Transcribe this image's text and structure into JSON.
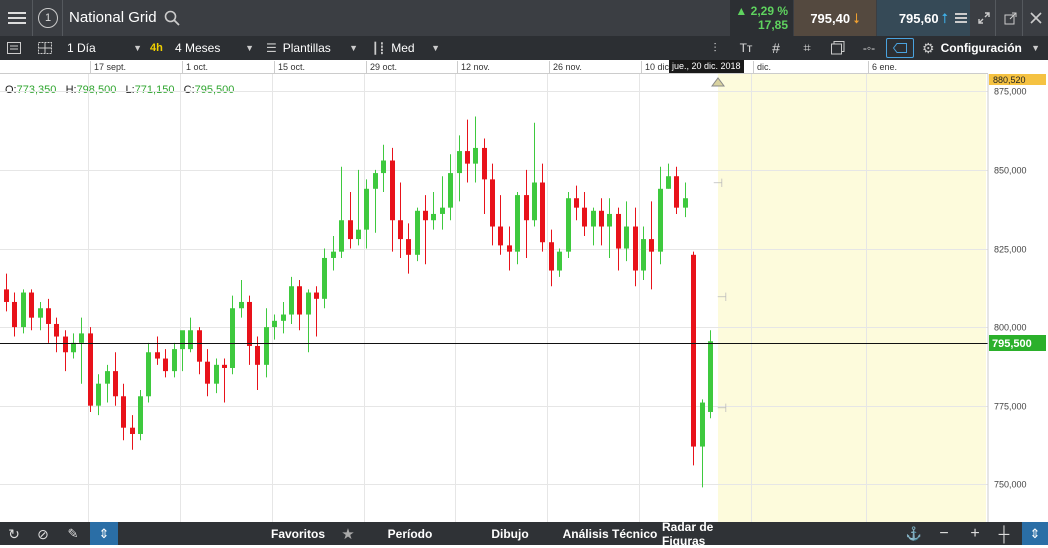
{
  "header": {
    "instrument_name": "National Grid",
    "step_badge": "1",
    "change_percent": "2,29 %",
    "change_abs": "17,85",
    "sell_price": "795,40",
    "buy_price": "795,60"
  },
  "toolbar": {
    "interval": "1 Día",
    "interval_badge": "4h",
    "range": "4 Meses",
    "templates": "Plantillas",
    "chart_type": "Med",
    "settings": "Configuración"
  },
  "date_axis": {
    "labels": [
      "17 sept.",
      "1 oct.",
      "15 oct.",
      "29 oct.",
      "12 nov.",
      "26 nov.",
      "10 dic.",
      "dic.",
      "6 ene."
    ],
    "cursor_date": "jue., 20 dic. 2018"
  },
  "ohlc": {
    "o_label": "O:",
    "o": "773,350",
    "h_label": "H:",
    "h": "798,500",
    "l_label": "L:",
    "l": "771,150",
    "c_label": "C:",
    "c": "795,500"
  },
  "price_axis": {
    "ticks": [
      "875,000",
      "850,000",
      "825,000",
      "800,000",
      "775,000",
      "750,000"
    ],
    "top_label": "880,520",
    "current_label": "795,500"
  },
  "chart_data": {
    "type": "candlestick",
    "ylim": [
      738,
      880.52
    ],
    "current_price": 795.5,
    "up_color": "#3ec93e",
    "down_color": "#e8121a",
    "candles": [
      [
        812,
        817,
        805,
        808
      ],
      [
        808,
        811,
        797,
        800
      ],
      [
        800,
        812,
        798,
        811
      ],
      [
        811,
        812,
        799,
        803
      ],
      [
        803,
        808,
        799,
        806
      ],
      [
        806,
        809,
        795,
        801
      ],
      [
        801,
        803,
        792,
        797
      ],
      [
        797,
        799,
        786,
        792
      ],
      [
        792,
        798,
        790,
        795
      ],
      [
        795,
        803,
        782,
        798
      ],
      [
        798,
        800,
        773,
        775
      ],
      [
        775,
        785,
        772,
        782
      ],
      [
        782,
        788,
        776,
        786
      ],
      [
        786,
        792,
        775,
        778
      ],
      [
        778,
        782,
        764,
        768
      ],
      [
        768,
        772,
        761,
        766
      ],
      [
        766,
        780,
        764,
        778
      ],
      [
        778,
        795,
        776,
        792
      ],
      [
        792,
        797,
        788,
        790
      ],
      [
        790,
        793,
        784,
        786
      ],
      [
        786,
        795,
        784,
        793
      ],
      [
        793,
        797,
        786,
        799
      ],
      [
        793,
        803,
        792,
        799
      ],
      [
        799,
        800,
        785,
        789
      ],
      [
        789,
        793,
        778,
        782
      ],
      [
        782,
        790,
        779,
        788
      ],
      [
        788,
        790,
        776,
        787
      ],
      [
        787,
        810,
        785,
        806
      ],
      [
        806,
        815,
        803,
        808
      ],
      [
        808,
        810,
        788,
        794
      ],
      [
        794,
        797,
        780,
        788
      ],
      [
        788,
        806,
        784,
        800
      ],
      [
        800,
        804,
        796,
        802
      ],
      [
        802,
        808,
        798,
        804
      ],
      [
        804,
        816,
        801,
        813
      ],
      [
        813,
        815,
        799,
        804
      ],
      [
        804,
        812,
        792,
        811
      ],
      [
        811,
        813,
        797,
        809
      ],
      [
        809,
        825,
        806,
        822
      ],
      [
        822,
        829,
        818,
        824
      ],
      [
        824,
        851,
        822,
        834
      ],
      [
        834,
        843,
        825,
        828
      ],
      [
        828,
        850,
        826,
        831
      ],
      [
        831,
        847,
        825,
        844
      ],
      [
        844,
        850,
        830,
        849
      ],
      [
        849,
        858,
        843,
        853
      ],
      [
        853,
        857,
        824,
        834
      ],
      [
        834,
        846,
        822,
        828
      ],
      [
        828,
        833,
        817,
        823
      ],
      [
        823,
        838,
        821,
        837
      ],
      [
        837,
        842,
        820,
        834
      ],
      [
        834,
        843,
        831,
        836
      ],
      [
        836,
        848,
        831,
        838
      ],
      [
        838,
        855,
        834,
        849
      ],
      [
        849,
        861,
        840,
        856
      ],
      [
        856,
        866,
        846,
        852
      ],
      [
        852,
        867,
        846,
        857
      ],
      [
        857,
        860,
        836,
        847
      ],
      [
        847,
        852,
        826,
        832
      ],
      [
        832,
        842,
        823,
        826
      ],
      [
        826,
        832,
        818,
        824
      ],
      [
        824,
        843,
        820,
        842
      ],
      [
        842,
        850,
        822,
        834
      ],
      [
        834,
        865,
        832,
        846
      ],
      [
        846,
        852,
        824,
        827
      ],
      [
        827,
        831,
        813,
        818
      ],
      [
        818,
        825,
        816,
        824
      ],
      [
        824,
        843,
        822,
        841
      ],
      [
        841,
        845,
        834,
        838
      ],
      [
        838,
        843,
        829,
        832
      ],
      [
        832,
        838,
        826,
        837
      ],
      [
        837,
        841,
        826,
        832
      ],
      [
        832,
        841,
        822,
        836
      ],
      [
        836,
        838,
        818,
        825
      ],
      [
        825,
        840,
        821,
        832
      ],
      [
        832,
        838,
        813,
        818
      ],
      [
        818,
        832,
        815,
        828
      ],
      [
        828,
        840,
        812,
        824
      ],
      [
        824,
        851,
        820,
        844
      ],
      [
        844,
        852,
        844,
        848
      ],
      [
        848,
        851,
        836,
        838
      ],
      [
        838,
        846,
        835,
        841
      ],
      [
        823,
        824,
        756,
        762
      ],
      [
        762,
        777,
        749,
        776
      ],
      [
        773,
        799,
        771,
        795.5
      ]
    ]
  }
}
